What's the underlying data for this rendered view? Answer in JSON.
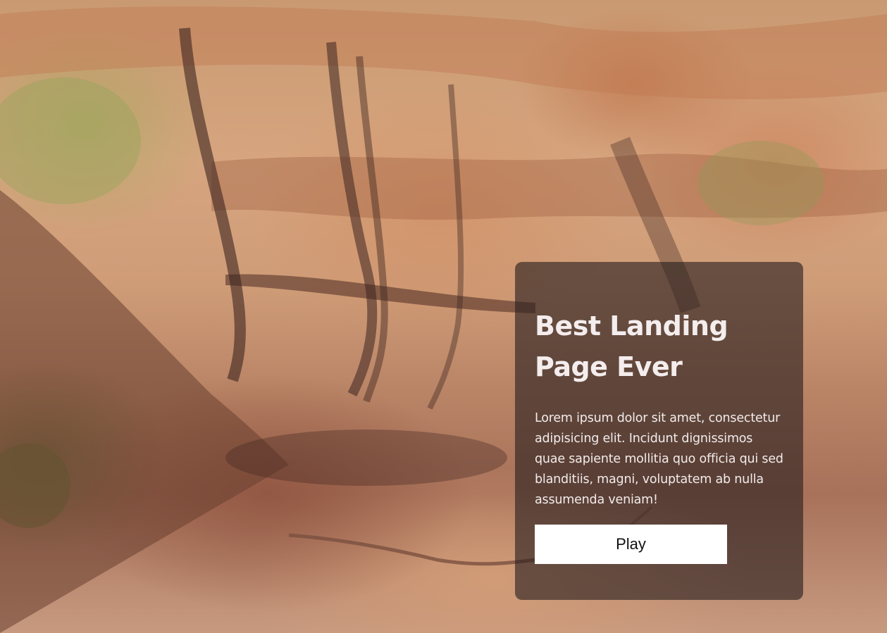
{
  "hero": {
    "background": "sandstone-rock-photo",
    "card": {
      "title": "Best Landing Page Ever",
      "text": "Lorem ipsum dolor sit amet, consectetur adipisicing elit. Incidunt dignissimos quae sapiente mollitia quo officia qui sed blanditiis, magni, voluptatem ab nulla assumenda veniam!",
      "button_label": "Play",
      "background_color": "#281e1e",
      "button_color": "#ffffff"
    }
  }
}
